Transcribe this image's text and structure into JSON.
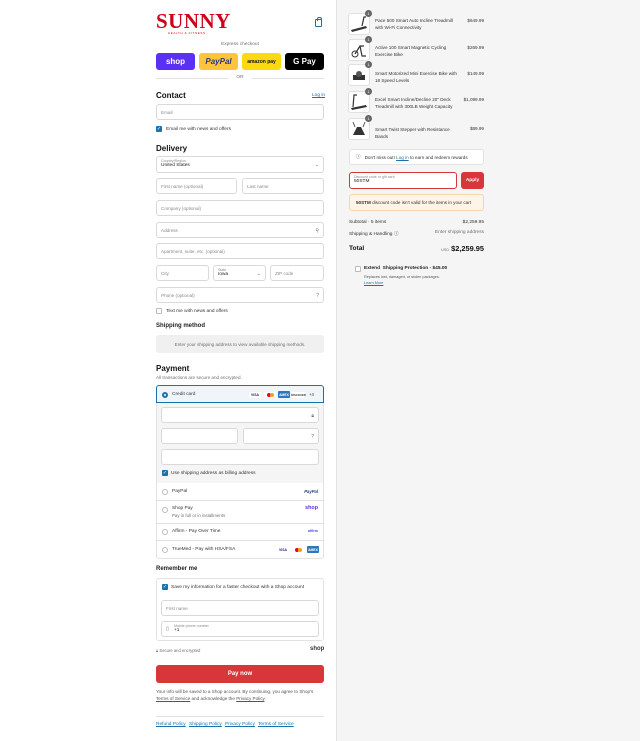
{
  "brand": {
    "name": "SUNNY",
    "tagline": "HEALTH & FITNESS"
  },
  "express": {
    "title": "Express checkout",
    "shop": "shop",
    "paypal": "PayPal",
    "amazon": "amazon pay",
    "gpay": "G Pay",
    "or": "OR"
  },
  "contact": {
    "title": "Contact",
    "login": "Log in",
    "email_placeholder": "Email",
    "news": "Email me with news and offers"
  },
  "delivery": {
    "title": "Delivery",
    "country_label": "Country/Region",
    "country": "United States",
    "first": "First name (optional)",
    "last": "Last name",
    "company": "Company (optional)",
    "address": "Address",
    "apartment": "Apartment, suite, etc. (optional)",
    "city": "City",
    "state_label": "State",
    "state": "Iowa",
    "zip": "ZIP code",
    "phone": "Phone (optional)",
    "text_me": "Text me with news and offers"
  },
  "shipping": {
    "title": "Shipping method",
    "notice": "Enter your shipping address to view available shipping methods."
  },
  "payment": {
    "title": "Payment",
    "subtitle": "All transactions are secure and encrypted.",
    "credit": "Credit card",
    "more": "+4",
    "billing": "Use shipping address as billing address",
    "paypal": "PayPal",
    "shoppay": "Shop Pay",
    "shoppay_sub": "Pay in full or in installments",
    "affirm": "Affirm - Pay Over Time",
    "truemed": "TrueMed - Pay with HSA/FSA",
    "card_brands": [
      "VISA",
      "MC",
      "AMEX",
      "DISCOVER"
    ]
  },
  "remember": {
    "title": "Remember me",
    "save": "Save my information for a faster checkout with a Shop account",
    "first": "First name",
    "mobile_label": "Mobile phone number",
    "mobile": "+1",
    "secure": "Secure and encrypted",
    "shop": "shop"
  },
  "pay_button": "Pay now",
  "legal": {
    "line1": "Your info will be saved to a Shop account. By continuing, you agree to Shop's",
    "terms": "Terms of Service",
    "and": "and acknowledge the",
    "privacy": "Privacy Policy"
  },
  "footer": [
    "Refund Policy",
    "Shipping Policy",
    "Privacy Policy",
    "Terms of Service"
  ],
  "cart": [
    {
      "qty": "1",
      "name": "Pace 500 Smart Auto Incline Treadmill with Wi-Fi Connectivity",
      "price": "$649.99"
    },
    {
      "qty": "1",
      "name": "Active 100 Smart Magnetic Cycling Exercise Bike",
      "price": "$269.99"
    },
    {
      "qty": "1",
      "name": "Smart Motorized Mini Exercise Bike with 18 Speed Levels",
      "price": "$149.99"
    },
    {
      "qty": "1",
      "name": "Excel Smart Incline/Decline 20\" Deck Treadmill with 300LB Weight Capacity",
      "price": "$1,099.99"
    },
    {
      "qty": "1",
      "name": "Smart Twist Stepper with Resistance Bands",
      "price": "$89.99"
    }
  ],
  "rewards": {
    "pre": "Don't miss out!",
    "link": "Log in",
    "post": "to earn and redeem rewards"
  },
  "discount": {
    "label": "Discount code or gift card",
    "value": "50STM",
    "apply": "Apply",
    "error_code": "50STM",
    "error_msg": "discount code isn't valid for the items in your cart"
  },
  "summary": {
    "subtotal_label": "Subtotal · 5 items",
    "subtotal": "$2,259.95",
    "shipping_label": "Shipping & Handling",
    "shipping": "Enter shipping address",
    "total_label": "Total",
    "currency": "USD",
    "total": "$2,259.95"
  },
  "extend": {
    "brand": "Extend",
    "title": "Shipping Protection - $45.00",
    "desc": "Replaces lost, damaged, or stolen packages.",
    "learn": "Learn More"
  },
  "colors": {
    "accent": "#1773b0",
    "brand": "#d0021b",
    "pay": "#d7363b",
    "shop": "#5a31f4",
    "paypal": "#ffc439",
    "amazon": "#ffd814"
  }
}
